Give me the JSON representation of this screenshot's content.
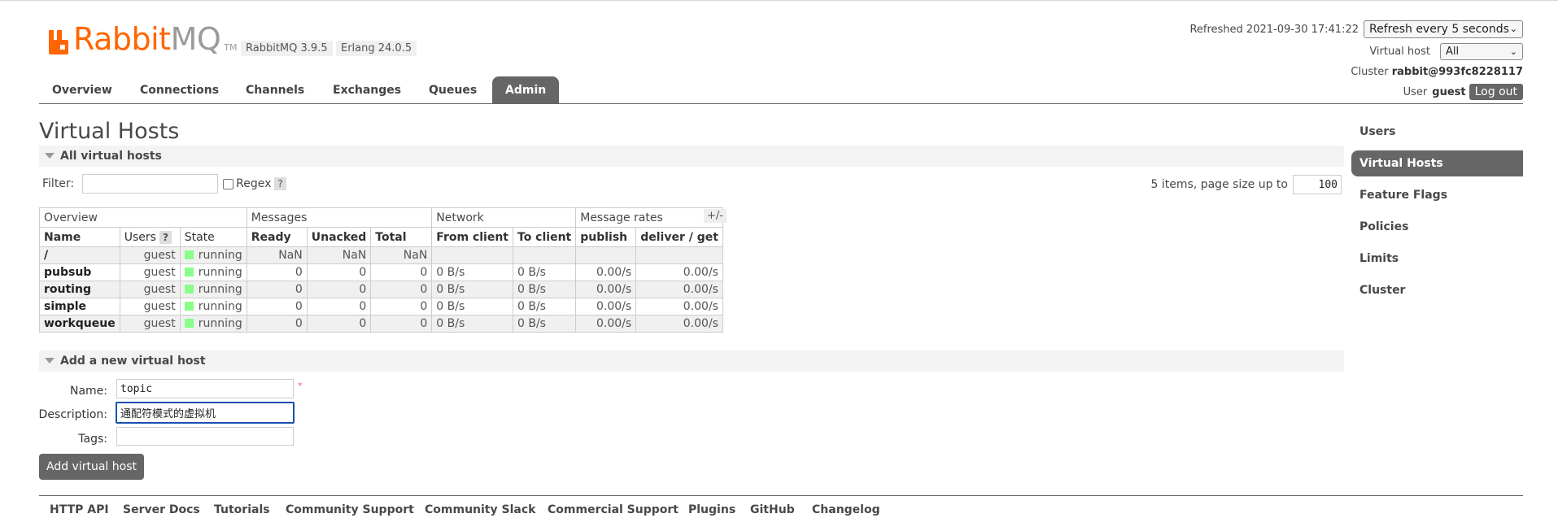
{
  "header": {
    "logo_rabbit": "Rabbit",
    "logo_mq": "MQ",
    "logo_tm": "TM",
    "version_rabbitmq": "RabbitMQ 3.9.5",
    "version_erlang": "Erlang 24.0.5",
    "refreshed_label": "Refreshed 2021-09-30 17:41:22",
    "refresh_select": "Refresh every 5 seconds",
    "vhost_label": "Virtual host",
    "vhost_select": "All",
    "cluster_label": "Cluster",
    "cluster_name": "rabbit@993fc8228117",
    "user_label": "User",
    "user_name": "guest",
    "logout_label": "Log out"
  },
  "nav": {
    "tabs": [
      "Overview",
      "Connections",
      "Channels",
      "Exchanges",
      "Queues",
      "Admin"
    ],
    "active": "Admin"
  },
  "page": {
    "title": "Virtual Hosts",
    "section_all": "All virtual hosts",
    "filter_label": "Filter:",
    "filter_value": "",
    "regex_label": "Regex",
    "help": "?",
    "pager_text": "5 items, page size up to",
    "page_size": "100",
    "plus_minus": "+/-"
  },
  "table": {
    "groups": [
      "Overview",
      "Messages",
      "Network",
      "Message rates"
    ],
    "columns": [
      "Name",
      "Users",
      "State",
      "Ready",
      "Unacked",
      "Total",
      "From client",
      "To client",
      "publish",
      "deliver / get"
    ],
    "rows": [
      {
        "name": "/",
        "users": "guest",
        "state": "running",
        "ready": "NaN",
        "unacked": "NaN",
        "total": "NaN",
        "from": "",
        "to": "",
        "publish": "",
        "deliver": ""
      },
      {
        "name": "pubsub",
        "users": "guest",
        "state": "running",
        "ready": "0",
        "unacked": "0",
        "total": "0",
        "from": "0 B/s",
        "to": "0 B/s",
        "publish": "0.00/s",
        "deliver": "0.00/s"
      },
      {
        "name": "routing",
        "users": "guest",
        "state": "running",
        "ready": "0",
        "unacked": "0",
        "total": "0",
        "from": "0 B/s",
        "to": "0 B/s",
        "publish": "0.00/s",
        "deliver": "0.00/s"
      },
      {
        "name": "simple",
        "users": "guest",
        "state": "running",
        "ready": "0",
        "unacked": "0",
        "total": "0",
        "from": "0 B/s",
        "to": "0 B/s",
        "publish": "0.00/s",
        "deliver": "0.00/s"
      },
      {
        "name": "workqueue",
        "users": "guest",
        "state": "running",
        "ready": "0",
        "unacked": "0",
        "total": "0",
        "from": "0 B/s",
        "to": "0 B/s",
        "publish": "0.00/s",
        "deliver": "0.00/s"
      }
    ],
    "state_color": "#88ff88"
  },
  "add_form": {
    "section": "Add a new virtual host",
    "name_label": "Name:",
    "name_value": "topic",
    "required_mark": "*",
    "description_label": "Description:",
    "description_value": "通配符模式的虚拟机",
    "tags_label": "Tags:",
    "tags_value": "",
    "submit_label": "Add virtual host"
  },
  "sidebar": {
    "items": [
      "Users",
      "Virtual Hosts",
      "Feature Flags",
      "Policies",
      "Limits",
      "Cluster"
    ],
    "active": "Virtual Hosts"
  },
  "footer": {
    "links": [
      "HTTP API",
      "Server Docs",
      "Tutorials",
      "Community Support",
      "Community Slack",
      "Commercial Support",
      "Plugins",
      "GitHub",
      "Changelog"
    ]
  },
  "colors": {
    "brand": "#ff6600",
    "accent": "#666666"
  }
}
